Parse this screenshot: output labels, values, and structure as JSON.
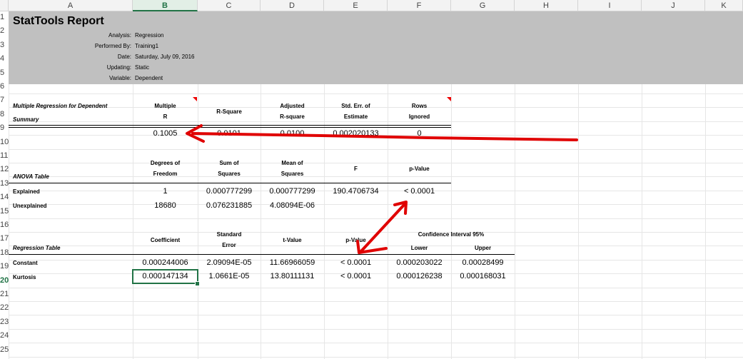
{
  "columns": [
    "A",
    "B",
    "C",
    "D",
    "E",
    "F",
    "G",
    "H",
    "I",
    "J",
    "K"
  ],
  "rows": [
    "1",
    "2",
    "3",
    "4",
    "5",
    "6",
    "7",
    "8",
    "9",
    "10",
    "11",
    "12",
    "13",
    "14",
    "15",
    "16",
    "17",
    "18",
    "19",
    "20",
    "21",
    "22",
    "23",
    "24",
    "25"
  ],
  "selected_column": "B",
  "selected_row": "20",
  "report": {
    "title": "StatTools Report",
    "meta": [
      {
        "label": "Analysis:",
        "value": "Regression"
      },
      {
        "label": "Performed By:",
        "value": "Training1"
      },
      {
        "label": "Date:",
        "value": "Saturday, July 09, 2016"
      },
      {
        "label": "Updating:",
        "value": "Static"
      },
      {
        "label": "Variable:",
        "value": "Dependent"
      }
    ]
  },
  "summary": {
    "title_line1": "Multiple Regression for Dependent",
    "title_line2": "Summary",
    "headers": {
      "multiple_r": [
        "Multiple",
        "R"
      ],
      "r_square": "R-Square",
      "adjusted": [
        "Adjusted",
        "R-square"
      ],
      "std_err": [
        "Std. Err. of",
        "Estimate"
      ],
      "rows_ignored": [
        "Rows",
        "Ignored"
      ]
    },
    "values": {
      "multiple_r": "0.1005",
      "r_square": "0.0101",
      "adjusted": "0.0100",
      "std_err": "0.002020133",
      "rows_ignored": "0"
    }
  },
  "anova": {
    "title": "ANOVA Table",
    "headers": {
      "df": [
        "Degrees of",
        "Freedom"
      ],
      "ss": [
        "Sum of",
        "Squares"
      ],
      "ms": [
        "Mean of",
        "Squares"
      ],
      "f": "F",
      "p": "p-Value"
    },
    "rows": [
      {
        "label": "Explained",
        "df": "1",
        "ss": "0.000777299",
        "ms": "0.000777299",
        "f": "190.4706734",
        "p": "< 0.0001"
      },
      {
        "label": "Unexplained",
        "df": "18680",
        "ss": "0.076231885",
        "ms": "4.08094E-06",
        "f": "",
        "p": ""
      }
    ]
  },
  "regression": {
    "title": "Regression Table",
    "headers": {
      "coef": "Coefficient",
      "se": [
        "Standard",
        "Error"
      ],
      "t": "t-Value",
      "p": "p-Value",
      "ci": "Confidence Interval 95%",
      "lower": "Lower",
      "upper": "Upper"
    },
    "rows": [
      {
        "label": "Constant",
        "coef": "0.000244006",
        "se": "2.09094E-05",
        "t": "11.66966059",
        "p": "< 0.0001",
        "lower": "0.000203022",
        "upper": "0.00028499"
      },
      {
        "label": "Kurtosis",
        "coef": "0.000147134",
        "se": "1.0661E-05",
        "t": "13.80111131",
        "p": "< 0.0001",
        "lower": "0.000126238",
        "upper": "0.000168031"
      }
    ]
  },
  "colors": {
    "header_band": "#c0c0c0",
    "selection": "#217346",
    "annotation": "#e00000"
  }
}
